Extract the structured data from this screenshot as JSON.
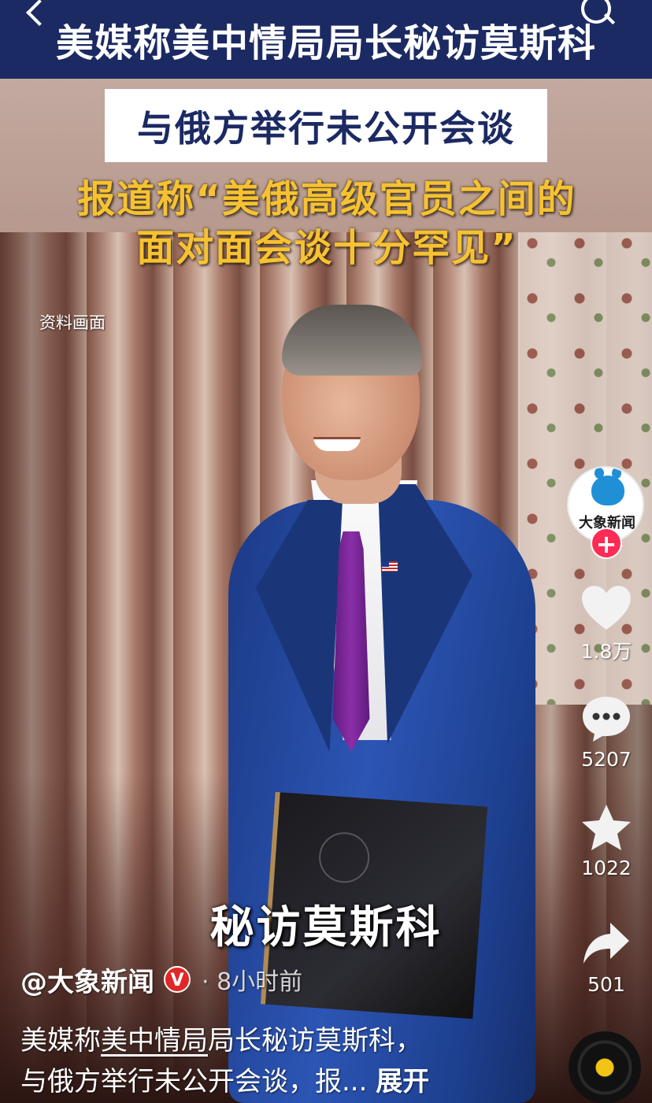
{
  "header": {
    "title": "美媒称美中情局局长秘访莫斯科",
    "subtitle": "与俄方举行未公开会谈",
    "headline_line1": "报道称“美俄高级官员之间的",
    "headline_line2": "面对面会谈十分罕见”"
  },
  "video": {
    "source_tag": "资料画面",
    "caption": "秘访莫斯科"
  },
  "actions": {
    "account_avatar_text": "大象新闻",
    "likes": "1.8万",
    "comments": "5207",
    "favorites": "1022",
    "shares": "501"
  },
  "post": {
    "author": "@大象新闻",
    "verified_mark": "V",
    "time": "· 8小时前",
    "desc_prefix": "美媒称",
    "desc_highlight": "美中情局",
    "desc_line1_rest": "局长秘访莫斯科，",
    "desc_line2": "与俄方举行未公开会谈，报... ",
    "expand_label": "展开"
  },
  "colors": {
    "title_bar": "#1c2a63",
    "headline_yellow": "#f6c231",
    "follow_red": "#fe2c55",
    "verified_red": "#e02727"
  },
  "icons": [
    "back-icon",
    "search-icon",
    "heart-icon",
    "comment-icon",
    "star-icon",
    "share-icon",
    "music-disc-icon"
  ]
}
